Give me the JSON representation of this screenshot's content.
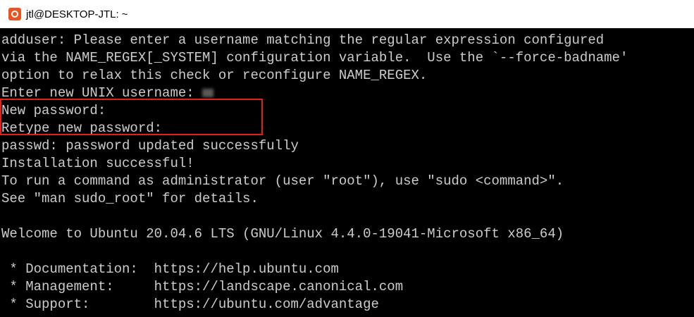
{
  "window": {
    "title": "jtl@DESKTOP-JTL: ~",
    "icon": "ubuntu-icon"
  },
  "terminal": {
    "lines": [
      "adduser: Please enter a username matching the regular expression configured",
      "via the NAME_REGEX[_SYSTEM] configuration variable.  Use the `--force-badname'",
      "option to relax this check or reconfigure NAME_REGEX.",
      "Enter new UNIX username: ",
      "New password:",
      "Retype new password:",
      "passwd: password updated successfully",
      "Installation successful!",
      "To run a command as administrator (user \"root\"), use \"sudo <command>\".",
      "See \"man sudo_root\" for details.",
      "",
      "Welcome to Ubuntu 20.04.6 LTS (GNU/Linux 4.4.0-19041-Microsoft x86_64)",
      "",
      " * Documentation:  https://help.ubuntu.com",
      " * Management:     https://landscape.canonical.com",
      " * Support:        https://ubuntu.com/advantage"
    ]
  },
  "colors": {
    "terminal_bg": "#000000",
    "terminal_fg": "#cccccc",
    "highlight": "#e0201a",
    "ubuntu_orange": "#e95420"
  }
}
